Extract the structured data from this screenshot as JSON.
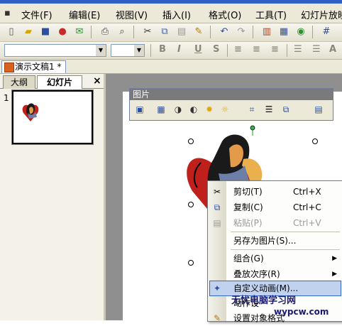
{
  "window": {
    "title": ""
  },
  "menubar": {
    "items": [
      "文件(F)",
      "编辑(E)",
      "视图(V)",
      "插入(I)",
      "格式(O)",
      "工具(T)",
      "幻灯片放映"
    ]
  },
  "document": {
    "tab_label": "演示文稿1 *"
  },
  "left_panel": {
    "tabs": [
      "大纲",
      "幻灯片"
    ],
    "close_symbol": "×",
    "slide_number": "1"
  },
  "picture_toolbar": {
    "title": "图片"
  },
  "context_menu": {
    "items": [
      {
        "label": "剪切(T)",
        "shortcut": "Ctrl+X",
        "icon": "scissors-icon",
        "enabled": true
      },
      {
        "label": "复制(C)",
        "shortcut": "Ctrl+C",
        "icon": "copy-icon",
        "enabled": true
      },
      {
        "label": "粘贴(P)",
        "shortcut": "Ctrl+V",
        "icon": "paste-icon",
        "enabled": false
      },
      {
        "label": "另存为图片(S)...",
        "shortcut": "",
        "icon": "",
        "enabled": true
      },
      {
        "label": "组合(G)",
        "shortcut": "",
        "icon": "",
        "enabled": true,
        "submenu": true
      },
      {
        "label": "叠放次序(R)",
        "shortcut": "",
        "icon": "",
        "enabled": true,
        "submenu": true
      },
      {
        "label": "自定义动画(M)...",
        "shortcut": "",
        "icon": "animation-icon",
        "enabled": true,
        "highlighted": true
      },
      {
        "label": "动作设",
        "shortcut": "",
        "icon": "",
        "enabled": true
      },
      {
        "label": "设置对象格式",
        "shortcut": "",
        "icon": "format-object-icon",
        "enabled": true
      }
    ]
  },
  "watermark": {
    "line1": "无忧电脑学习网",
    "line2": "wypcw.com"
  },
  "colors": {
    "menu_bg": "#ece9d8",
    "highlight": "#c1d2ee",
    "highlight_border": "#316ac5",
    "slide_bg": "#8f8f8f"
  }
}
